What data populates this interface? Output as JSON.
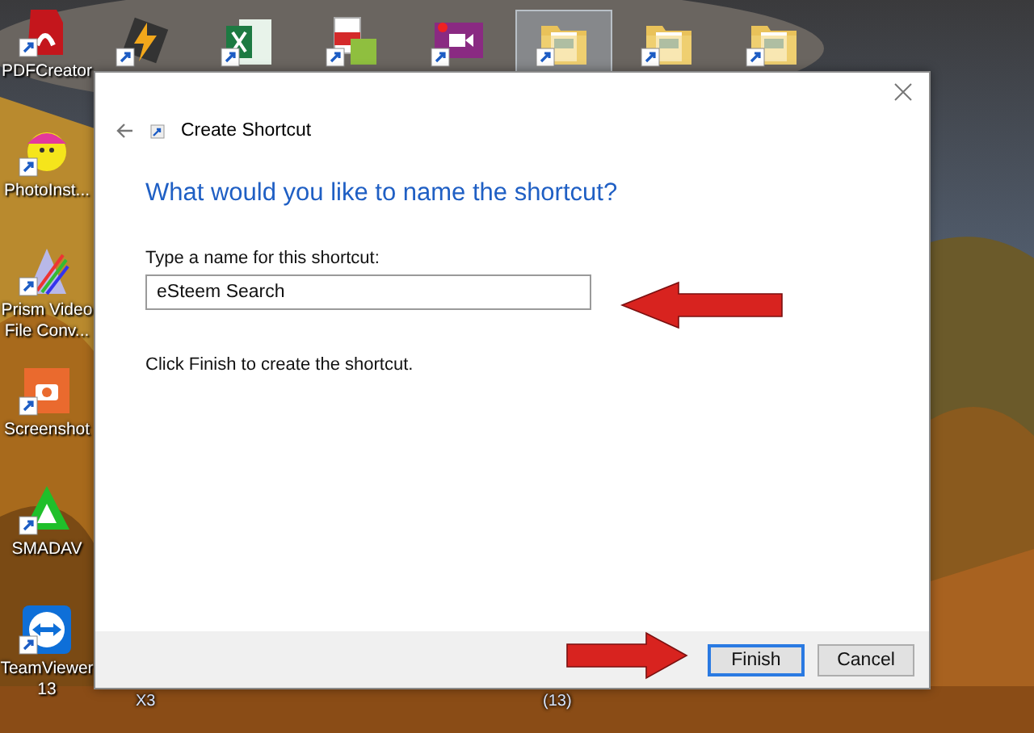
{
  "desktop": {
    "top_icons": [
      {
        "kind": "bolt"
      },
      {
        "kind": "excel-like"
      },
      {
        "kind": "converter"
      },
      {
        "kind": "recorder"
      },
      {
        "kind": "folder",
        "selected": true
      },
      {
        "kind": "folder",
        "selected": false
      },
      {
        "kind": "folder",
        "selected": false
      }
    ],
    "side_icons": [
      {
        "kind": "pdf",
        "label": "PDFCreator"
      },
      {
        "kind": "smiley",
        "label": "PhotoInst..."
      },
      {
        "kind": "prism",
        "label": "Prism Video File Conv..."
      },
      {
        "kind": "camera",
        "label": "Screenshot"
      },
      {
        "kind": "smadav",
        "label": "SMADAV"
      },
      {
        "kind": "teamviewer",
        "label": "TeamViewer 13"
      }
    ],
    "cut_labels": [
      "X3",
      "(13)"
    ]
  },
  "dialog": {
    "title": "Create Shortcut",
    "heading": "What would you like to name the shortcut?",
    "field_label": "Type a name for this shortcut:",
    "field_value": "eSteem Search",
    "instruction": "Click Finish to create the shortcut.",
    "buttons": [
      {
        "label": "Finish",
        "focused": true
      },
      {
        "label": "Cancel",
        "focused": false
      }
    ]
  }
}
